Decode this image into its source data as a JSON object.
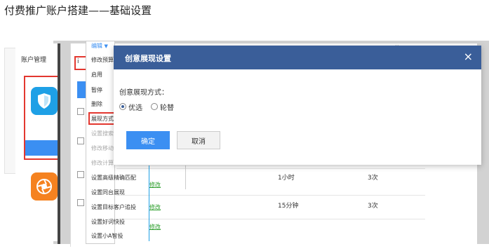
{
  "slide": {
    "title": "付费推广账户搭建——基础设置"
  },
  "left_panel": {
    "account_label": "账户管理"
  },
  "table": {
    "mid_label": "i",
    "header_mark": "修",
    "rows": [
      {
        "edit": "修改",
        "time": "1小时",
        "count": "3次"
      },
      {
        "edit": "修改",
        "time": "15分钟",
        "count": "3次"
      },
      {
        "edit": "修改"
      }
    ]
  },
  "edit_menu": {
    "label": "编辑",
    "items": [
      {
        "label": "修改预算",
        "enabled": true
      },
      {
        "label": "启用",
        "enabled": true
      },
      {
        "label": "暂停",
        "enabled": true
      },
      {
        "label": "删除",
        "enabled": true
      },
      {
        "label": "展现方式",
        "enabled": true
      },
      {
        "label": "设置搜索",
        "enabled": false
      },
      {
        "label": "修改移动",
        "enabled": false
      },
      {
        "label": "修改计算",
        "enabled": false
      },
      {
        "label": "设置高级精确匹配",
        "enabled": true
      },
      {
        "label": "设置同台展现",
        "enabled": true
      },
      {
        "label": "设置目标客户追投",
        "enabled": true
      },
      {
        "label": "设置好词快投",
        "enabled": true
      },
      {
        "label": "设置小A智投",
        "enabled": true
      }
    ]
  },
  "modal": {
    "title": "创意展现设置",
    "close": "×",
    "field_label": "创意展现方式：",
    "options": [
      {
        "label": "优选",
        "selected": true
      },
      {
        "label": "轮替",
        "selected": false
      }
    ],
    "ok_label": "确定",
    "cancel_label": "取消"
  },
  "colors": {
    "modal_header": "#3a5e99",
    "primary": "#3b8ff2",
    "highlight_red": "#e3372f",
    "shield_blue": "#1ea0e6",
    "orange": "#f58220"
  }
}
